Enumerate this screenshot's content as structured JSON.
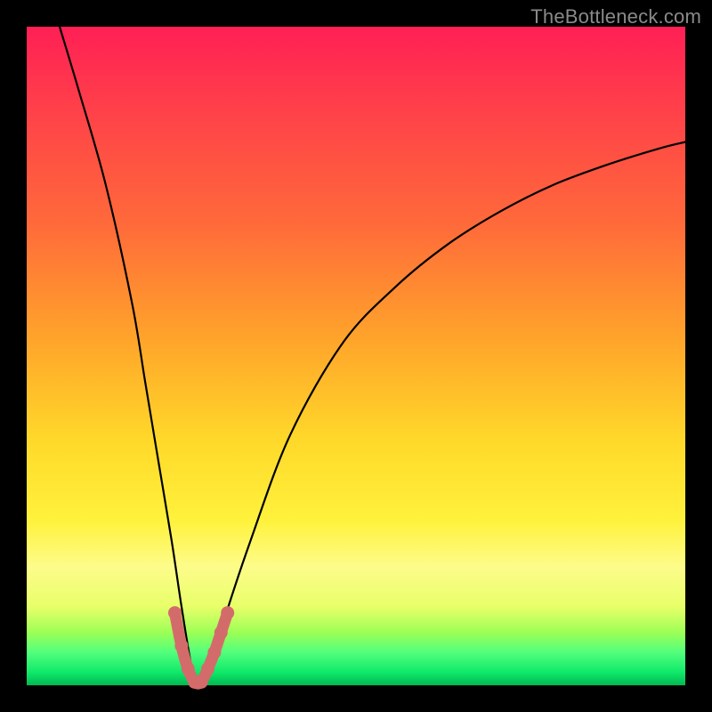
{
  "domain": "Chart",
  "watermark": "TheBottleneck.com",
  "colors": {
    "page_bg": "#000000",
    "watermark_text": "#8a8a8a",
    "curve_stroke": "#000000",
    "highlight_stroke": "#d46b6b"
  },
  "chart_data": {
    "type": "line",
    "title": "",
    "xlabel": "",
    "ylabel": "",
    "xlim": [
      0,
      100
    ],
    "ylim": [
      0,
      100
    ],
    "grid": false,
    "legend": false,
    "series": [
      {
        "name": "bottleneck-curve",
        "x": [
          5,
          8,
          12,
          16,
          18,
          20,
          22,
          23.5,
          25,
          26,
          28,
          30,
          34,
          40,
          48,
          56,
          64,
          72,
          80,
          88,
          96,
          100
        ],
        "y": [
          100,
          90,
          76,
          58,
          46,
          34,
          22,
          12,
          3,
          0,
          3,
          10,
          22,
          38,
          52,
          60.5,
          67,
          72,
          76,
          79,
          81.5,
          82.5
        ]
      },
      {
        "name": "highlight-trough-segment",
        "x": [
          22.5,
          23.5,
          24.5,
          25.5,
          26.5,
          27.5,
          28.5,
          29.5,
          30.5
        ],
        "y": [
          11,
          6,
          2.5,
          0.5,
          0.5,
          2.5,
          5,
          8,
          11
        ]
      }
    ],
    "annotations": []
  }
}
